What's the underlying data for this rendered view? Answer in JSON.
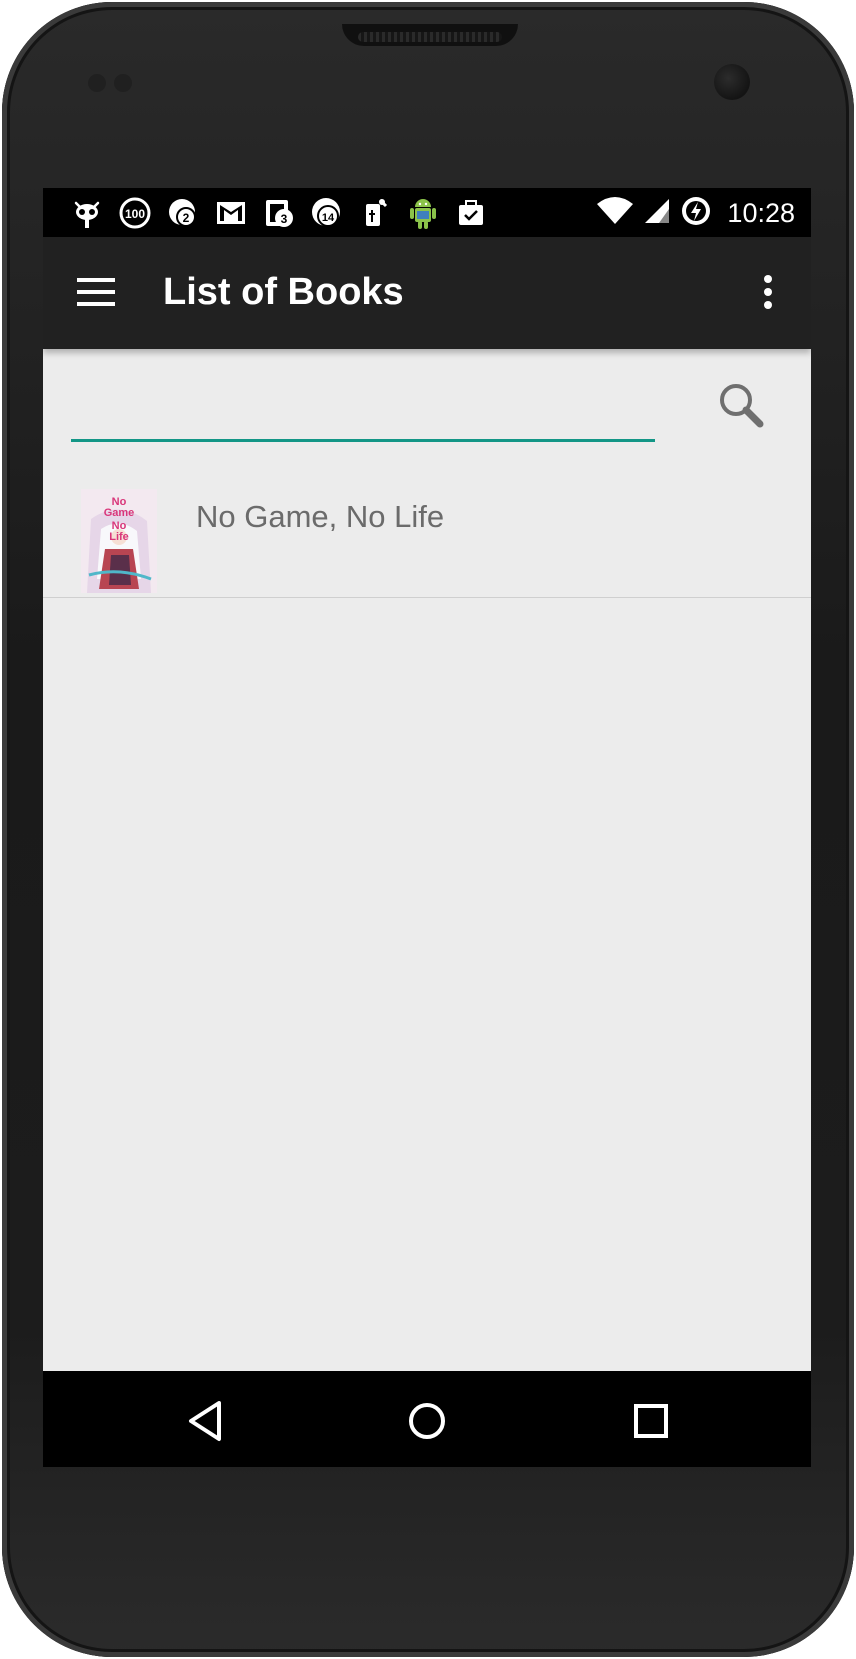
{
  "status_bar": {
    "time": "10:28",
    "notification_icons": [
      {
        "icon": "cyanogenmod-icon",
        "badge": ""
      },
      {
        "icon": "battery-100-icon",
        "badge": "100"
      },
      {
        "icon": "notification-count-icon",
        "badge": "2"
      },
      {
        "icon": "gmail-icon",
        "badge": ""
      },
      {
        "icon": "multi-window-icon",
        "badge": "3"
      },
      {
        "icon": "notification-count-icon",
        "badge": "14"
      },
      {
        "icon": "usb-debug-icon",
        "badge": ""
      },
      {
        "icon": "android-icon",
        "badge": ""
      },
      {
        "icon": "task-done-icon",
        "badge": ""
      }
    ],
    "right_icons": [
      "wifi-icon",
      "signal-icon",
      "battery-charging-icon"
    ]
  },
  "app_bar": {
    "title": "List of Books",
    "menu_icon": "hamburger-menu-icon",
    "overflow_icon": "more-vert-icon"
  },
  "search": {
    "value": "",
    "placeholder": "",
    "button_icon": "search-icon",
    "underline_color": "#139686"
  },
  "books": [
    {
      "title": "No Game, No Life",
      "cover_text": "No Game No Life"
    }
  ],
  "nav_bar": {
    "back_icon": "back-icon",
    "home_icon": "home-icon",
    "recents_icon": "recents-icon"
  },
  "colors": {
    "app_bar": "#212121",
    "background": "#ececec",
    "accent": "#139686",
    "title_text": "#6b6b6b"
  }
}
